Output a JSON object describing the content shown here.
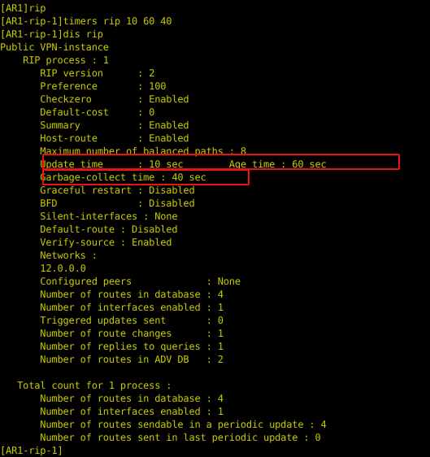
{
  "terminal": {
    "background_color": "#000000",
    "text_color": "#c9c900",
    "annotation_color": "#ee1111",
    "console_output": "[AR1]rip\n[AR1-rip-1]timers rip 10 60 40\n[AR1-rip-1]dis rip\nPublic VPN-instance\n    RIP process : 1\n       RIP version      : 2\n       Preference       : 100\n       Checkzero        : Enabled\n       Default-cost     : 0\n       Summary          : Enabled\n       Host-route       : Enabled\n       Maximum number of balanced paths : 8\n       Update time      : 10 sec        Age time : 60 sec\n       Garbage-collect time : 40 sec\n       Graceful restart : Disabled\n       BFD              : Disabled\n       Silent-interfaces : None\n       Default-route : Disabled\n       Verify-source : Enabled\n       Networks :\n       12.0.0.0\n       Configured peers             : None\n       Number of routes in database : 4\n       Number of interfaces enabled : 1\n       Triggered updates sent       : 0\n       Number of route changes      : 1\n       Number of replies to queries : 1\n       Number of routes in ADV DB   : 2\n\n   Total count for 1 process :\n       Number of routes in database : 4\n       Number of interfaces enabled : 1\n       Number of routes sendable in a periodic update : 4\n       Number of routes sent in last periodic update : 0\n[AR1-rip-1]",
    "lines": [
      {
        "text": "[AR1]rip",
        "kind": "prompt-command"
      },
      {
        "text": "[AR1-rip-1]timers rip 10 60 40",
        "kind": "prompt-command"
      },
      {
        "text": "[AR1-rip-1]dis rip",
        "kind": "prompt-command"
      },
      {
        "text": "Public VPN-instance",
        "kind": "output"
      },
      {
        "text": "    RIP process : 1",
        "kind": "output"
      },
      {
        "text": "       RIP version      : 2",
        "kind": "output"
      },
      {
        "text": "       Preference       : 100",
        "kind": "output"
      },
      {
        "text": "       Checkzero        : Enabled",
        "kind": "output"
      },
      {
        "text": "       Default-cost     : 0",
        "kind": "output"
      },
      {
        "text": "       Summary          : Enabled",
        "kind": "output"
      },
      {
        "text": "       Host-route       : Enabled",
        "kind": "output"
      },
      {
        "text": "       Maximum number of balanced paths : 8",
        "kind": "output"
      },
      {
        "text": "       Update time      : 10 sec        Age time : 60 sec",
        "kind": "output-highlighted"
      },
      {
        "text": "       Garbage-collect time : 40 sec",
        "kind": "output-highlighted"
      },
      {
        "text": "       Graceful restart : Disabled",
        "kind": "output"
      },
      {
        "text": "       BFD              : Disabled",
        "kind": "output"
      },
      {
        "text": "       Silent-interfaces : None",
        "kind": "output"
      },
      {
        "text": "       Default-route : Disabled",
        "kind": "output"
      },
      {
        "text": "       Verify-source : Enabled",
        "kind": "output"
      },
      {
        "text": "       Networks :",
        "kind": "output"
      },
      {
        "text": "       12.0.0.0",
        "kind": "output"
      },
      {
        "text": "       Configured peers             : None",
        "kind": "output"
      },
      {
        "text": "       Number of routes in database : 4",
        "kind": "output"
      },
      {
        "text": "       Number of interfaces enabled : 1",
        "kind": "output"
      },
      {
        "text": "       Triggered updates sent       : 0",
        "kind": "output"
      },
      {
        "text": "       Number of route changes      : 1",
        "kind": "output"
      },
      {
        "text": "       Number of replies to queries : 1",
        "kind": "output"
      },
      {
        "text": "       Number of routes in ADV DB   : 2",
        "kind": "output"
      },
      {
        "text": "",
        "kind": "blank"
      },
      {
        "text": "   Total count for 1 process :",
        "kind": "output"
      },
      {
        "text": "       Number of routes in database : 4",
        "kind": "output"
      },
      {
        "text": "       Number of interfaces enabled : 1",
        "kind": "output"
      },
      {
        "text": "       Number of routes sendable in a periodic update : 4",
        "kind": "output"
      },
      {
        "text": "       Number of routes sent in last periodic update : 0",
        "kind": "output"
      },
      {
        "text": "[AR1-rip-1]",
        "kind": "prompt"
      }
    ],
    "commands": [
      {
        "prompt": "[AR1]",
        "command": "rip"
      },
      {
        "prompt": "[AR1-rip-1]",
        "command": "timers rip 10 60 40"
      },
      {
        "prompt": "[AR1-rip-1]",
        "command": "dis rip"
      }
    ],
    "rip_process": {
      "vpn_instance": "Public VPN-instance",
      "process_id": "1",
      "fields": [
        {
          "label": "RIP version",
          "value": "2"
        },
        {
          "label": "Preference",
          "value": "100"
        },
        {
          "label": "Checkzero",
          "value": "Enabled"
        },
        {
          "label": "Default-cost",
          "value": "0"
        },
        {
          "label": "Summary",
          "value": "Enabled"
        },
        {
          "label": "Host-route",
          "value": "Enabled"
        },
        {
          "label": "Maximum number of balanced paths",
          "value": "8"
        },
        {
          "label": "Update time",
          "value": "10 sec"
        },
        {
          "label": "Age time",
          "value": "60 sec"
        },
        {
          "label": "Garbage-collect time",
          "value": "40 sec"
        },
        {
          "label": "Graceful restart",
          "value": "Disabled"
        },
        {
          "label": "BFD",
          "value": "Disabled"
        },
        {
          "label": "Silent-interfaces",
          "value": "None"
        },
        {
          "label": "Default-route",
          "value": "Disabled"
        },
        {
          "label": "Verify-source",
          "value": "Enabled"
        },
        {
          "label": "Networks",
          "value": "12.0.0.0"
        },
        {
          "label": "Configured peers",
          "value": "None"
        },
        {
          "label": "Number of routes in database",
          "value": "4"
        },
        {
          "label": "Number of interfaces enabled",
          "value": "1"
        },
        {
          "label": "Triggered updates sent",
          "value": "0"
        },
        {
          "label": "Number of route changes",
          "value": "1"
        },
        {
          "label": "Number of replies to queries",
          "value": "1"
        },
        {
          "label": "Number of routes in ADV DB",
          "value": "2"
        }
      ]
    },
    "total_count": {
      "heading": "Total count for 1 process :",
      "fields": [
        {
          "label": "Number of routes in database",
          "value": "4"
        },
        {
          "label": "Number of interfaces enabled",
          "value": "1"
        },
        {
          "label": "Number of routes sendable in a periodic update",
          "value": "4"
        },
        {
          "label": "Number of routes sent in last periodic update",
          "value": "0"
        }
      ]
    },
    "final_prompt": "[AR1-rip-1]",
    "annotations": [
      {
        "name": "update-time-age-time-highlight",
        "label": "Update time : 10 sec        Age time : 60 sec"
      },
      {
        "name": "garbage-collect-time-highlight",
        "label": "Garbage-collect time : 40 sec"
      }
    ]
  }
}
